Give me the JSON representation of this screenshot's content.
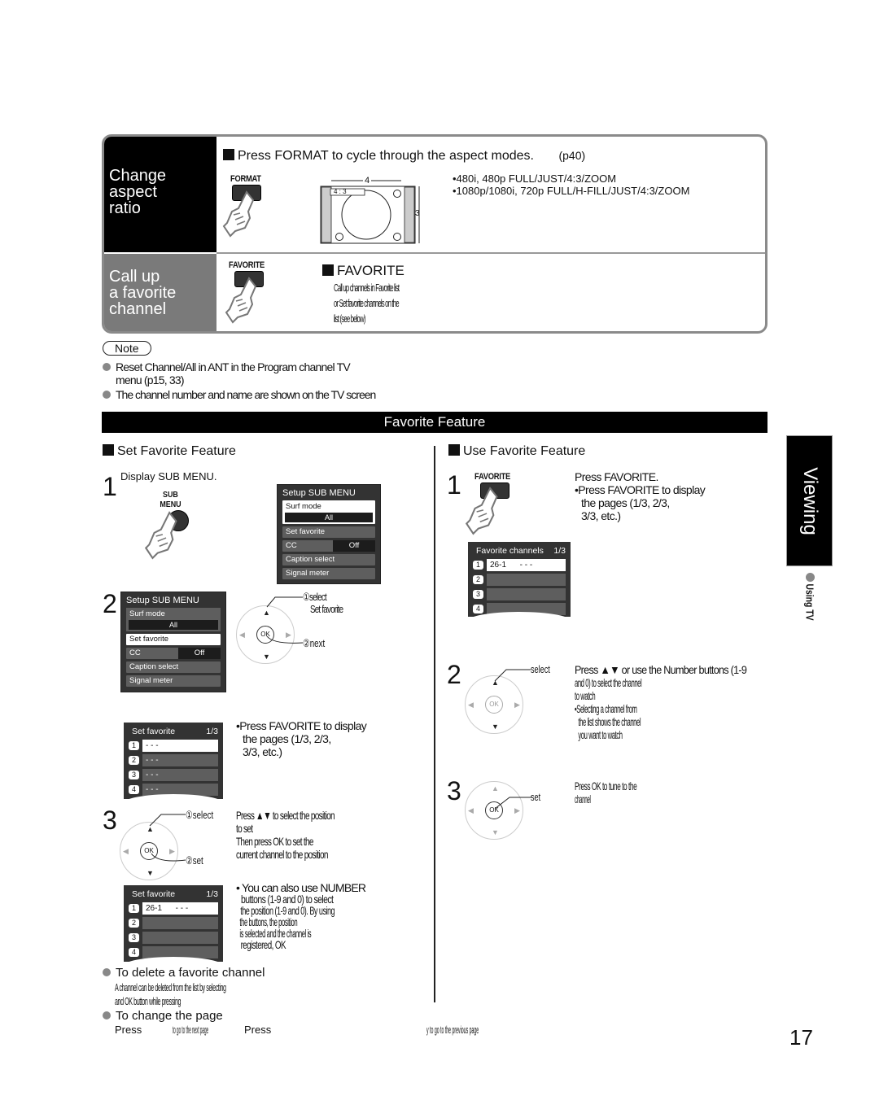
{
  "top_box": {
    "row1": {
      "label_lines": [
        "Change",
        "aspect",
        "ratio"
      ],
      "button_label": "FORMAT",
      "heading": "Press FORMAT to cycle through the aspect modes.",
      "page_ref": "(p40)",
      "diagram": {
        "width_label": "4",
        "height_label": "3",
        "mode_label": "4 : 3"
      },
      "modes": [
        "•480i, 480p FULL/JUST/4:3/ZOOM",
        "•1080p/1080i, 720p FULL/H-FILL/JUST/4:3/ZOOM"
      ]
    },
    "row2": {
      "label_lines": [
        "Call up",
        "a favorite",
        "channel"
      ],
      "button_label": "FAVORITE",
      "heading": "FAVORITE",
      "desc_lines": [
        "Call up channels in Favorite list",
        "or Set favorite channels on the",
        "list (see below)"
      ]
    }
  },
  "note": {
    "label": "Note",
    "items": [
      {
        "lines": [
          "Reset Channel/All in ANT in the Program channel TV",
          "menu (p15, 33)"
        ]
      },
      {
        "lines": [
          "The channel number and name are shown on the TV screen"
        ]
      }
    ]
  },
  "banner": "Favorite Feature",
  "set_section": {
    "heading": "Set Favorite Feature",
    "step1": {
      "num": "1",
      "text": "Display SUB MENU.",
      "button_label_lines": [
        "SUB",
        "MENU"
      ],
      "menu": {
        "title": "Setup SUB MENU",
        "surf_mode": "Surf mode",
        "surf_value": "All",
        "set_favorite": "Set favorite",
        "cc": "CC",
        "cc_value": "Off",
        "caption_select": "Caption select",
        "signal_meter": "Signal meter"
      }
    },
    "step2": {
      "num": "2",
      "callout1_lines": [
        "①select",
        "Set favorite"
      ],
      "callout2": "②next",
      "ok_label": "OK",
      "menu": {
        "title": "Setup SUB MENU",
        "surf_mode": "Surf mode",
        "surf_value": "All",
        "set_favorite": "Set favorite",
        "cc": "CC",
        "cc_value": "Off",
        "caption_select": "Caption select",
        "signal_meter": "Signal meter"
      },
      "fav_list": {
        "title": "Set favorite",
        "page": "1/3",
        "rows": [
          {
            "n": "1",
            "value": "- - -"
          },
          {
            "n": "2",
            "value": "- - -"
          },
          {
            "n": "3",
            "value": "- - -"
          },
          {
            "n": "4",
            "value": "- - -"
          }
        ]
      },
      "note_lines": [
        "•Press FAVORITE to display",
        "the pages (1/3, 2/3,",
        "3/3, etc.)"
      ]
    },
    "step3": {
      "num": "3",
      "callout1": "①select",
      "callout2": "②set",
      "ok_label": "OK",
      "text_lines": [
        "Press ▲▼ to select the position",
        "to set",
        "Then press OK to set the",
        "current channel to the position"
      ],
      "fav_list": {
        "title": "Set favorite",
        "page": "1/3",
        "rows": [
          {
            "n": "1",
            "value": "26-1      - - -"
          },
          {
            "n": "2",
            "value": ""
          },
          {
            "n": "3",
            "value": ""
          },
          {
            "n": "4",
            "value": ""
          }
        ]
      },
      "note_lines": [
        "• You can also use NUMBER",
        "buttons (1-9 and 0) to select",
        "the position (1-9 and 0). By using",
        "the buttons, the position",
        "is selected and the channel is",
        "registered, OK"
      ]
    },
    "delete": {
      "heading": "To delete a favorite channel",
      "lines": [
        "A channel can be deleted from the list by selecting",
        "and OK button while pressing"
      ]
    },
    "change_page": {
      "heading": "To change the page",
      "line_parts": [
        "Press",
        "to go to the next page",
        "Press",
        "y to go to the previous page"
      ]
    }
  },
  "use_section": {
    "heading": "Use Favorite Feature",
    "step1": {
      "num": "1",
      "button_label": "FAVORITE",
      "text_lines": [
        "Press FAVORITE.",
        "•Press FAVORITE to display",
        "the pages (1/3, 2/3,",
        "3/3, etc.)"
      ],
      "fav_list": {
        "title": "Favorite channels",
        "page": "1/3",
        "rows": [
          {
            "n": "1",
            "value": "26-1      - - -"
          },
          {
            "n": "2",
            "value": ""
          },
          {
            "n": "3",
            "value": ""
          },
          {
            "n": "4",
            "value": ""
          }
        ]
      }
    },
    "step2": {
      "num": "2",
      "callout": "select",
      "ok_label": "OK",
      "text_lines": [
        "Press ▲▼ or use the Number buttons (1-9",
        "and 0) to select the channel",
        "to watch",
        "•Selecting a channel from",
        "the list shows the channel",
        "you want to watch"
      ]
    },
    "step3": {
      "num": "3",
      "callout": "set",
      "ok_label": "OK",
      "text_lines": [
        "Press OK to tune to the",
        "channel"
      ]
    }
  },
  "side_tab": {
    "label": "Viewing",
    "sub_label": "Using TV"
  },
  "page_number": "17"
}
